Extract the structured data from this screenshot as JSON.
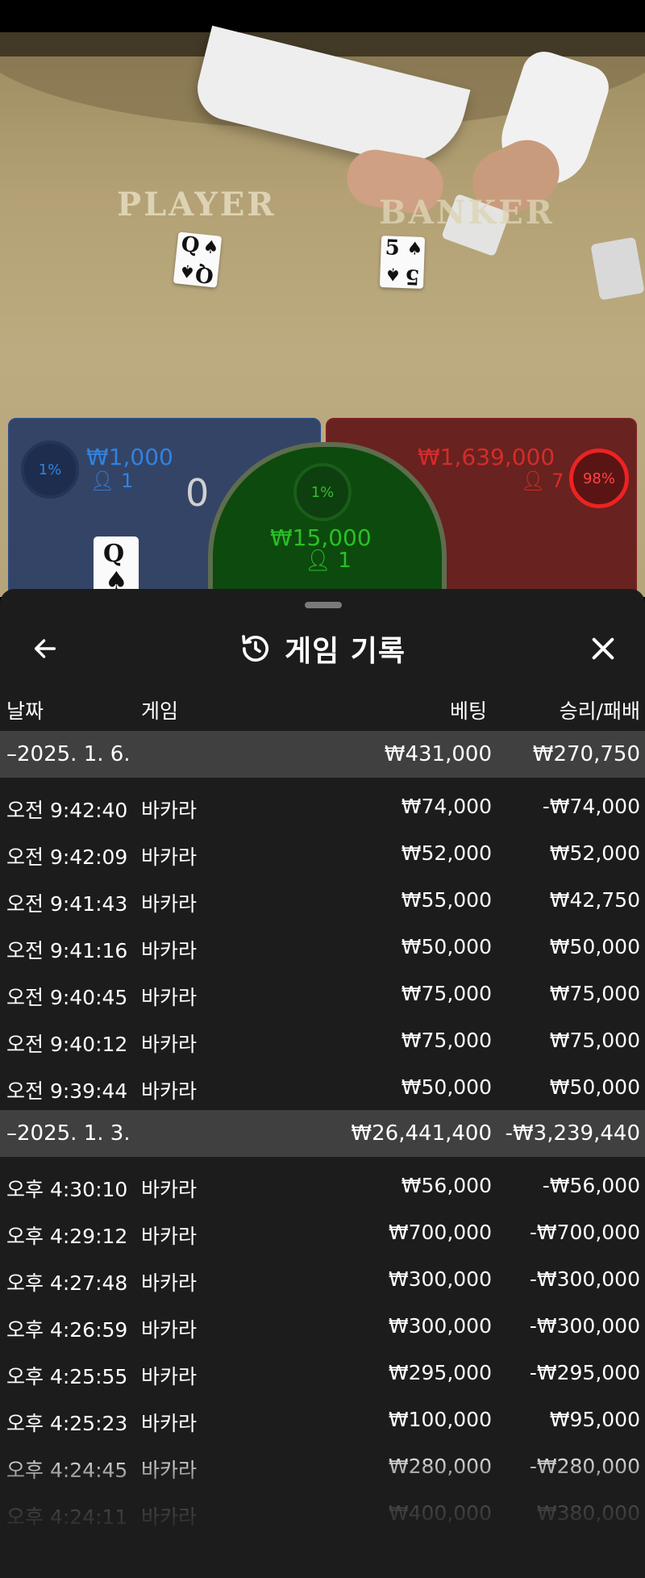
{
  "table": {
    "player_label": "PLAYER",
    "banker_label": "BANKER",
    "player_card": {
      "rank": "Q",
      "suit": "♠"
    },
    "banker_card": {
      "rank": "5",
      "suit": "♠"
    }
  },
  "bets": {
    "player": {
      "percent": "1%",
      "amount": "₩1,000",
      "count": "1",
      "score": "0",
      "card_rank": "Q",
      "card_suit": "♠",
      "color": "#2f83e0"
    },
    "tie": {
      "percent": "1%",
      "amount": "₩15,000",
      "count": "1",
      "color": "#27c127"
    },
    "banker": {
      "percent": "98%",
      "amount": "₩1,639,000",
      "count": "7",
      "color": "#d62b2b"
    }
  },
  "history": {
    "title": "게임 기록",
    "columns": {
      "date": "날짜",
      "game": "게임",
      "bet": "베팅",
      "result": "승리/패배"
    },
    "groups": [
      {
        "date": "–2025. 1. 6.",
        "total_bet": "₩431,000",
        "total_result": "₩270,750",
        "rows": [
          {
            "time": "오전 9:42:40",
            "game": "바카라",
            "bet": "₩74,000",
            "result": "-₩74,000"
          },
          {
            "time": "오전 9:42:09",
            "game": "바카라",
            "bet": "₩52,000",
            "result": "₩52,000"
          },
          {
            "time": "오전 9:41:43",
            "game": "바카라",
            "bet": "₩55,000",
            "result": "₩42,750"
          },
          {
            "time": "오전 9:41:16",
            "game": "바카라",
            "bet": "₩50,000",
            "result": "₩50,000"
          },
          {
            "time": "오전 9:40:45",
            "game": "바카라",
            "bet": "₩75,000",
            "result": "₩75,000"
          },
          {
            "time": "오전 9:40:12",
            "game": "바카라",
            "bet": "₩75,000",
            "result": "₩75,000"
          },
          {
            "time": "오전 9:39:44",
            "game": "바카라",
            "bet": "₩50,000",
            "result": "₩50,000"
          }
        ]
      },
      {
        "date": "–2025. 1. 3.",
        "total_bet": "₩26,441,400",
        "total_result": "-₩3,239,440",
        "rows": [
          {
            "time": "오후 4:30:10",
            "game": "바카라",
            "bet": "₩56,000",
            "result": "-₩56,000"
          },
          {
            "time": "오후 4:29:12",
            "game": "바카라",
            "bet": "₩700,000",
            "result": "-₩700,000"
          },
          {
            "time": "오후 4:27:48",
            "game": "바카라",
            "bet": "₩300,000",
            "result": "-₩300,000"
          },
          {
            "time": "오후 4:26:59",
            "game": "바카라",
            "bet": "₩300,000",
            "result": "-₩300,000"
          },
          {
            "time": "오후 4:25:55",
            "game": "바카라",
            "bet": "₩295,000",
            "result": "-₩295,000"
          },
          {
            "time": "오후 4:25:23",
            "game": "바카라",
            "bet": "₩100,000",
            "result": "₩95,000"
          },
          {
            "time": "오후 4:24:45",
            "game": "바카라",
            "bet": "₩280,000",
            "result": "-₩280,000"
          },
          {
            "time": "오후 4:24:11",
            "game": "바카라",
            "bet": "₩400,000",
            "result": "₩380,000"
          }
        ]
      }
    ]
  }
}
